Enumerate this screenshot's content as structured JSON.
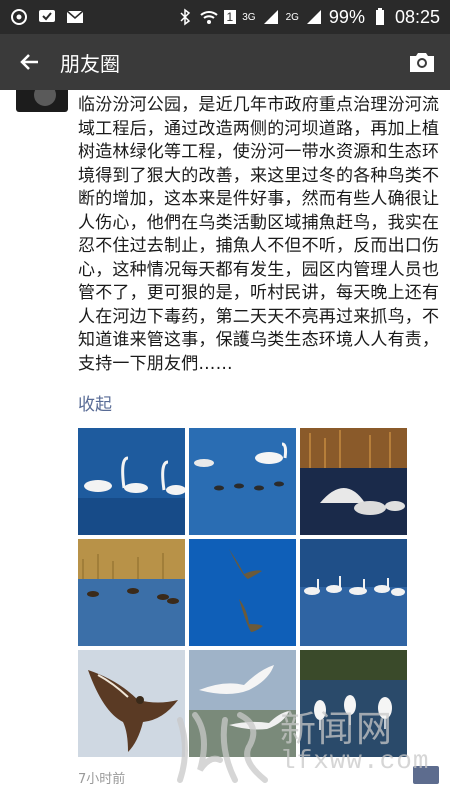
{
  "status_bar": {
    "battery": "99%",
    "time": "08:25",
    "network_labels": [
      "3G",
      "2G"
    ],
    "sim_label": "1"
  },
  "app_bar": {
    "title": "朋友圈"
  },
  "post": {
    "text": "临汾汾河公园，是近几年市政府重点治理汾河流域工程后，通过改造两侧的河坝道路，再加上植树造林绿化等工程，使汾河一带水资源和生态环境得到了狠大的改善，来这里过冬的各种鸟类不断的增加，这本来是件好事，然而有些人确很让人伤心，他們在乌类活動区域捕魚赶鸟，我实在忍不住过去制止，捕魚人不但不听，反而出口伤心，这种情况每天都有发生，园区内管理人员也管不了，更可狠的是，听村民讲，每天晚上还有人在河边下毒药，第二天天不亮再过来抓鸟，不知道谁来管这事，保護乌类生态环境人人有责，支持一下朋友們……",
    "collapse_label": "收起",
    "timestamp": "7小时前",
    "photos": [
      {
        "icon": "swans-photo"
      },
      {
        "icon": "swans-ducks-photo"
      },
      {
        "icon": "swans-reeds-photo"
      },
      {
        "icon": "ducks-grass-photo"
      },
      {
        "icon": "flying-ducks-photo"
      },
      {
        "icon": "swan-flock-photo"
      },
      {
        "icon": "bird-of-prey-photo"
      },
      {
        "icon": "flying-egrets-photo"
      },
      {
        "icon": "egrets-wetland-photo"
      }
    ]
  },
  "watermark": {
    "brand": "新闻网",
    "url": "lfxww.com"
  },
  "colors": {
    "status_bar": "#2a2a2a",
    "app_bar": "#3a3a3a",
    "link": "#586b95"
  }
}
